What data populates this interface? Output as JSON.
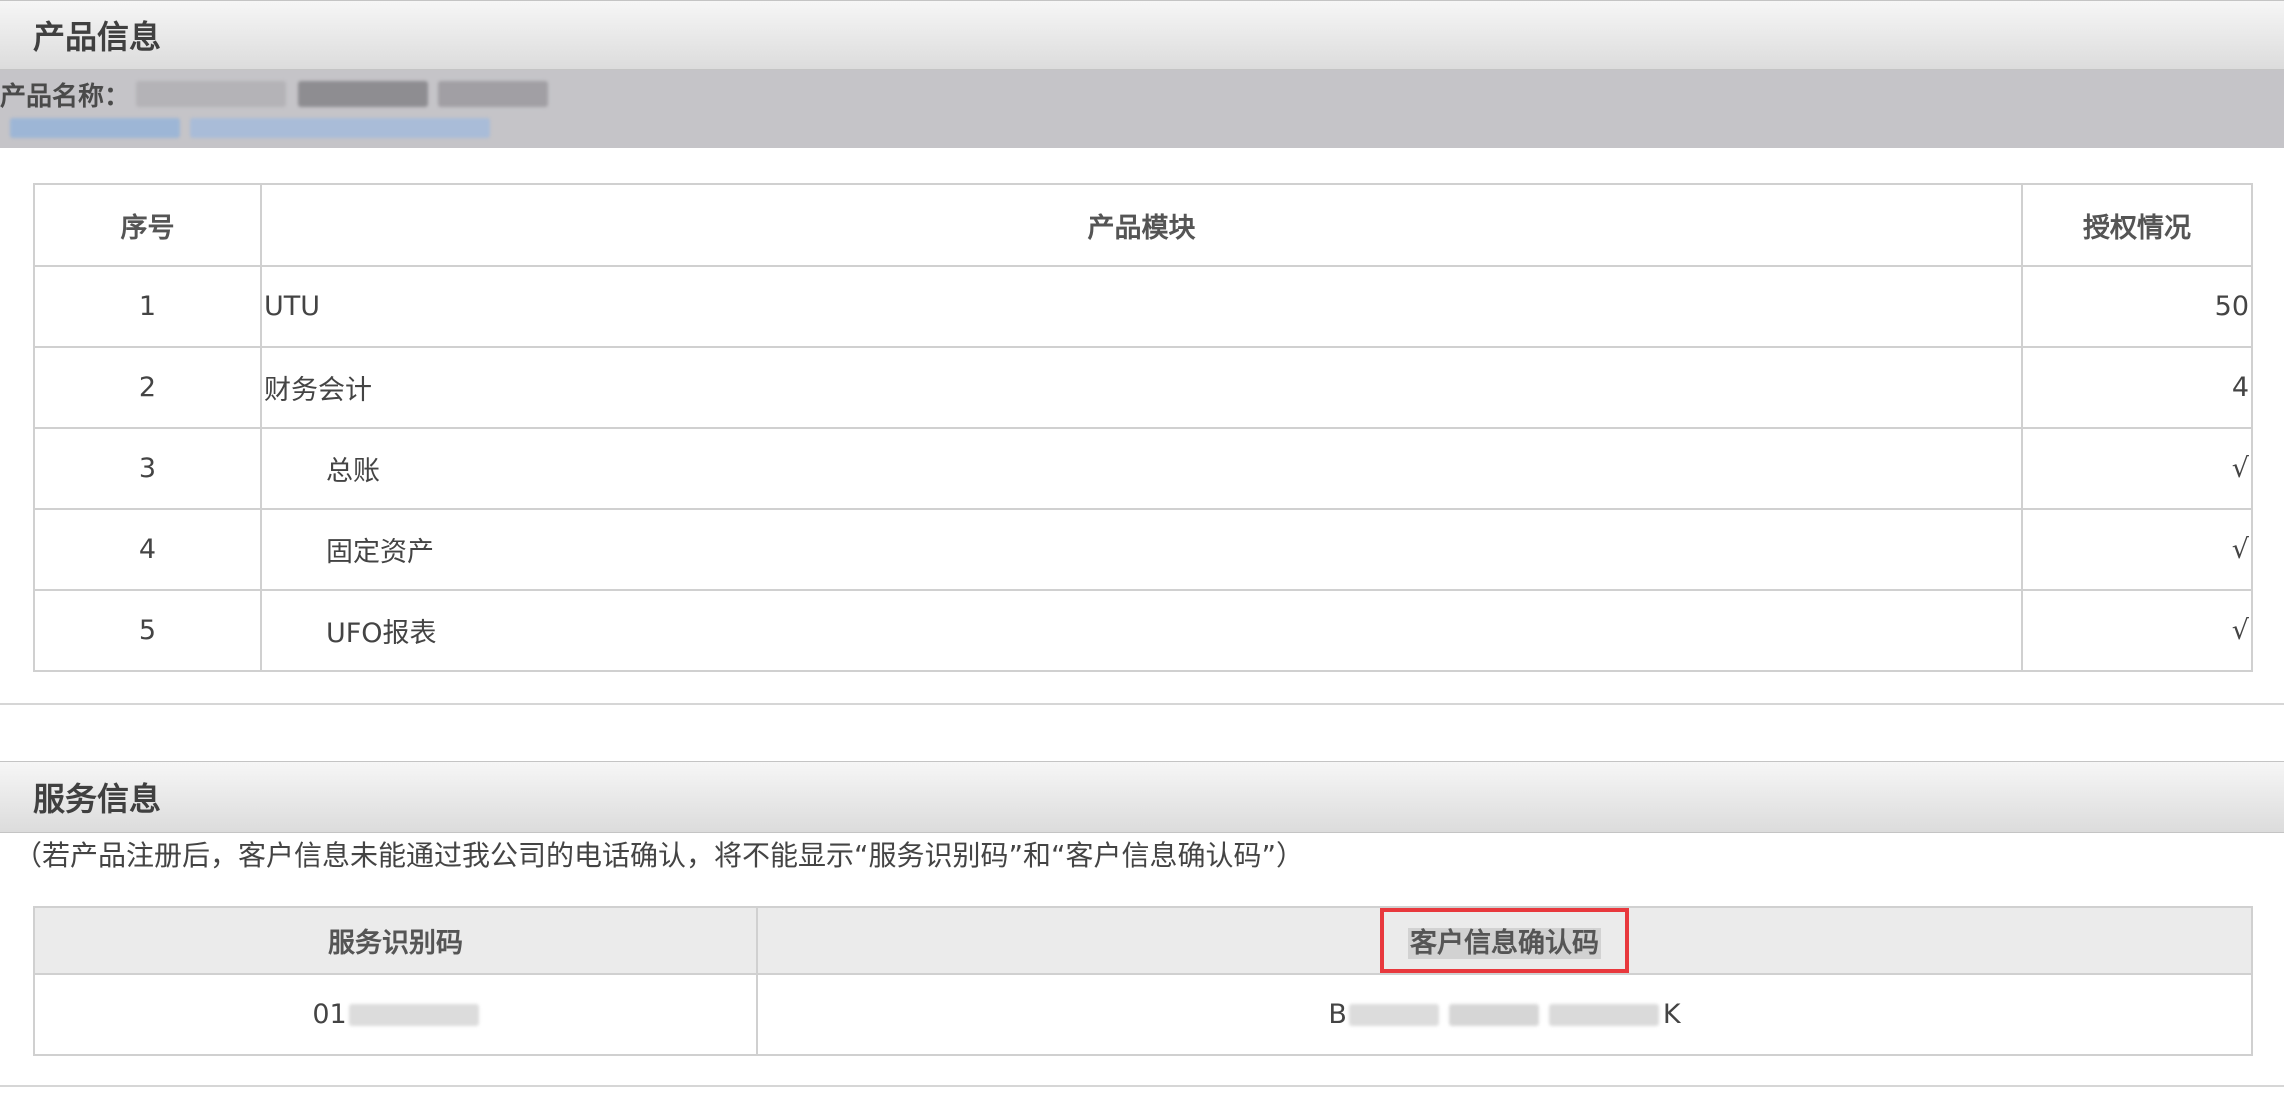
{
  "product_section": {
    "title": "产品信息",
    "name_label": "产品名称："
  },
  "module_table": {
    "headers": [
      "序号",
      "产品模块",
      "授权情况"
    ],
    "rows": [
      {
        "no": "1",
        "module": "UTU",
        "auth": "50",
        "indent": false
      },
      {
        "no": "2",
        "module": "财务会计",
        "auth": "4",
        "indent": false
      },
      {
        "no": "3",
        "module": "总账",
        "auth": "√",
        "indent": true
      },
      {
        "no": "4",
        "module": "固定资产",
        "auth": "√",
        "indent": true
      },
      {
        "no": "5",
        "module": "UFO报表",
        "auth": "√",
        "indent": true
      }
    ]
  },
  "service_section": {
    "title": "服务信息",
    "note": "（若产品注册后，客户信息未能通过我公司的电话确认，将不能显示“服务识别码”和“客户信息确认码”）"
  },
  "service_table": {
    "headers": [
      "服务识别码",
      "客户信息确认码"
    ],
    "service_code_prefix": "01",
    "confirm_code_prefix": "B",
    "confirm_code_suffix": "K"
  },
  "colors": {
    "highlight_border": "#e8383d",
    "band_gray": "#c5c4c8"
  }
}
